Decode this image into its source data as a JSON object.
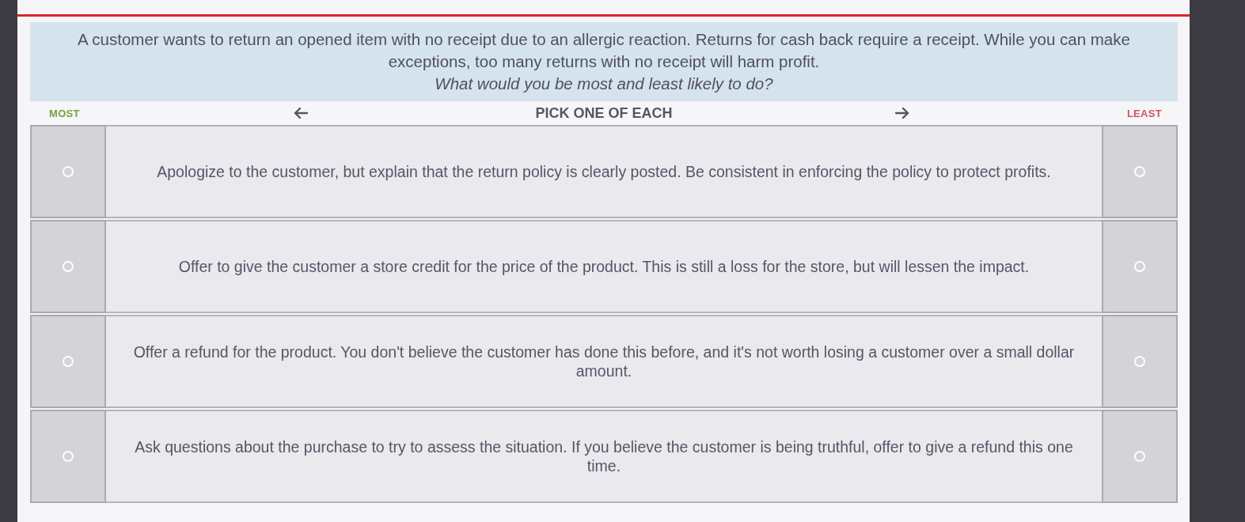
{
  "prompt": {
    "text": "A customer wants to return an opened item with no receipt due to an allergic reaction. Returns for cash back require a receipt. While you can make exceptions, too many returns with no receipt will harm profit.",
    "question": "What would you be most and least likely to do?"
  },
  "header": {
    "most_label": "MOST",
    "instruction": "PICK ONE OF EACH",
    "least_label": "LEAST"
  },
  "options": [
    {
      "text": "Apologize to the customer, but explain that the return policy is clearly posted. Be consistent in enforcing the policy to protect profits.",
      "most": {
        "selected": false
      },
      "least": {
        "selected": false
      }
    },
    {
      "text": "Offer to give the customer a store credit for the price of the product. This is still a loss for the store, but will lessen the impact.",
      "most": {
        "selected": false
      },
      "least": {
        "selected": false
      }
    },
    {
      "text": "Offer a refund for the product. You don't believe the customer has done this before, and it's not worth losing a customer over a small dollar amount.",
      "most": {
        "selected": false
      },
      "least": {
        "selected": false
      }
    },
    {
      "text": "Ask questions about the purchase to try to assess the situation. If you believe the customer is being truthful, offer to give a refund this one time.",
      "most": {
        "selected": false
      },
      "least": {
        "selected": false
      }
    }
  ]
}
